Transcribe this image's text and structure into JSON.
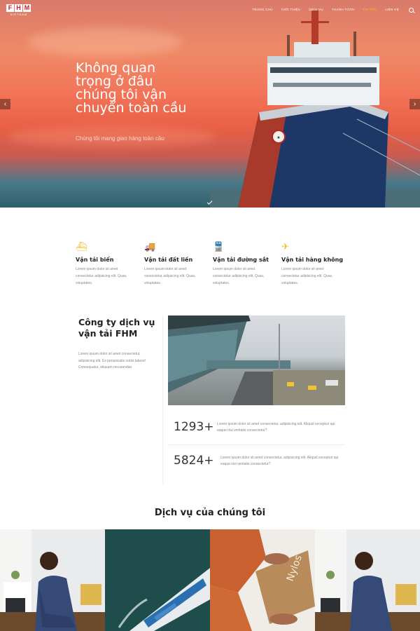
{
  "brand": {
    "logo_letters": [
      "F",
      "H",
      "M"
    ],
    "logo_sub": "VIETNAM"
  },
  "nav": {
    "items": [
      "Trang chủ",
      "Giới thiệu",
      "Dịch vụ",
      "Thanh toán",
      "Tin tức",
      "Liên hệ"
    ],
    "active_index": 4
  },
  "hero": {
    "title": "Không quan trọng ở đâu chúng tôi vận chuyển toàn cầu",
    "subtitle": "Chúng tôi mang giao hàng toàn cầu",
    "prev": "‹",
    "next": "›"
  },
  "features": [
    {
      "icon": "ship-icon",
      "glyph": "⛴",
      "title": "Vận tải biển",
      "text": "Lorem ipsum dolor sit amet consectetur adipiscing elit. Quas, voluptates."
    },
    {
      "icon": "truck-icon",
      "glyph": "🚚",
      "title": "Vận tải đất liền",
      "text": "Lorem ipsum dolor sit amet consectetur adipiscing elit. Quas, voluptates."
    },
    {
      "icon": "train-icon",
      "glyph": "🚆",
      "title": "Vận tải đường sắt",
      "text": "Lorem ipsum dolor sit amet consectetur adipiscing elit. Quas, voluptates."
    },
    {
      "icon": "plane-icon",
      "glyph": "✈",
      "title": "Vận tải hàng không",
      "text": "Lorem ipsum dolor sit amet consectetur adipiscing elit. Quas, voluptates."
    }
  ],
  "about": {
    "title": "Công ty dịch vụ vận tải FHM",
    "text": "Lorem ipsum dolor sit amet consectetur, adipisicing elit. Ex perspiciatis nobis labore! Consequatur, aliquam recusandae.",
    "stats": [
      {
        "number": "1293+",
        "text": "Lorem ipsum dolor sit amet consectetur, adipisicing elit. Aliquid excepturi qui eaque nisi veritatis consectetur?"
      },
      {
        "number": "5824+",
        "text": "Lorem ipsum dolor sit amet consectetur, adipisicing elit. Aliquid excepturi qui eaque nisi veritatis consectetur?"
      }
    ]
  },
  "services": {
    "title": "Dịch vụ của chúng tôi",
    "box_label": "Nylos"
  },
  "colors": {
    "accent": "#f2c12e",
    "brand_red": "#c31f2b"
  }
}
